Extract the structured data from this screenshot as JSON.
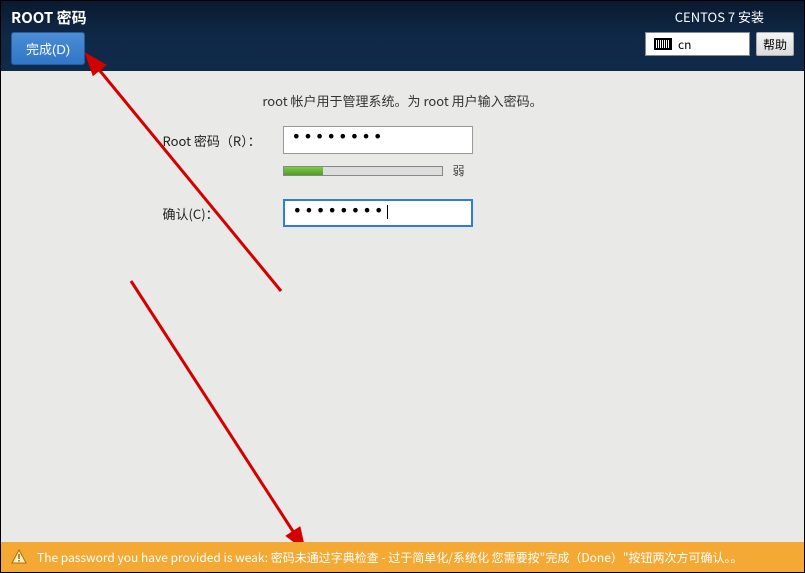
{
  "header": {
    "title": "ROOT 密码",
    "done_label": "完成(D)",
    "installer_title": "CENTOS 7 安装",
    "lang_code": "cn",
    "help_label": "帮助"
  },
  "form": {
    "instruction": "root 帐户用于管理系统。为 root 用户输入密码。",
    "root_label": "Root 密码（R）：",
    "root_value": "••••••••",
    "confirm_label": "确认(C)：",
    "confirm_value": "••••••••",
    "strength_text": "弱"
  },
  "warning": {
    "text": "The password you have provided is weak: 密码未通过字典检查 - 过于简单化/系统化 您需要按\"完成（Done）\"按钮两次方可确认。。"
  }
}
